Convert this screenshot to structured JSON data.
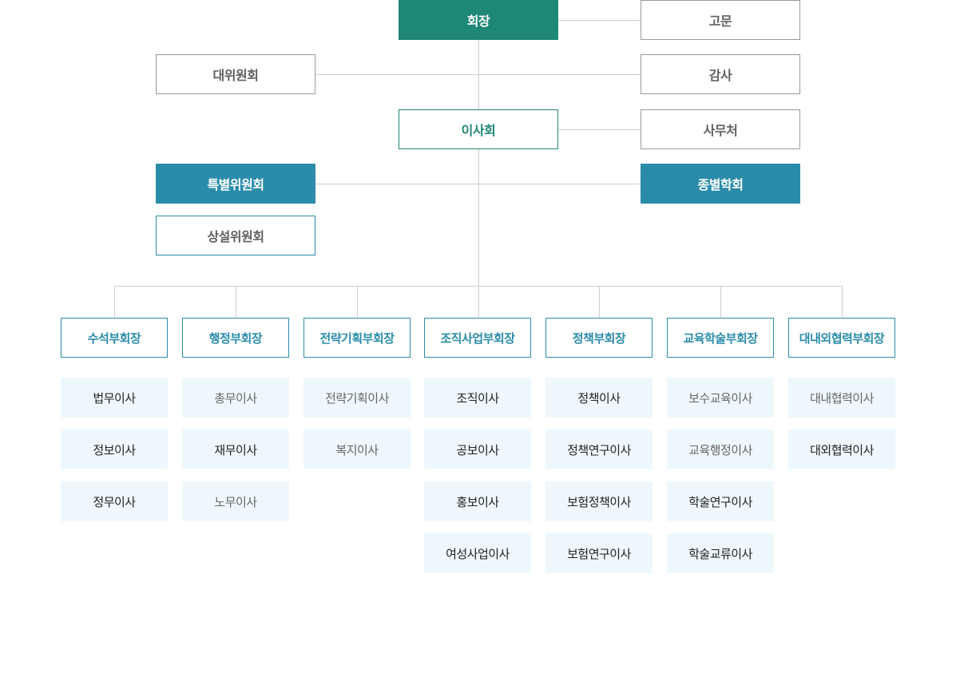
{
  "top": {
    "president": "회장",
    "advisor": "고문",
    "assembly": "대위원회",
    "auditor": "감사",
    "board": "이사회",
    "secretariat": "사무처",
    "special_committee": "특별위원회",
    "specialty_societies": "종별학회",
    "standing_committee": "상설위원회"
  },
  "vice_presidents": [
    {
      "label": "수석부회장",
      "directors": [
        "법무이사",
        "정보이사",
        "정무이사"
      ]
    },
    {
      "label": "행정부회장",
      "directors": [
        "총무이사",
        "재무이사",
        "노무이사"
      ]
    },
    {
      "label": "전략기획부회장",
      "directors": [
        "전략기획이사",
        "복지이사"
      ]
    },
    {
      "label": "조직사업부회장",
      "directors": [
        "조직이사",
        "공보이사",
        "홍보이사",
        "여성사업이사"
      ]
    },
    {
      "label": "정책부회장",
      "directors": [
        "정책이사",
        "정책연구이사",
        "보험정책이사",
        "보험연구이사"
      ]
    },
    {
      "label": "교육학술부회장",
      "directors": [
        "보수교육이사",
        "교육행정이사",
        "학술연구이사",
        "학술교류이사"
      ]
    },
    {
      "label": "대내외협력부회장",
      "directors": [
        "대내협력이사",
        "대외협력이사"
      ]
    }
  ]
}
